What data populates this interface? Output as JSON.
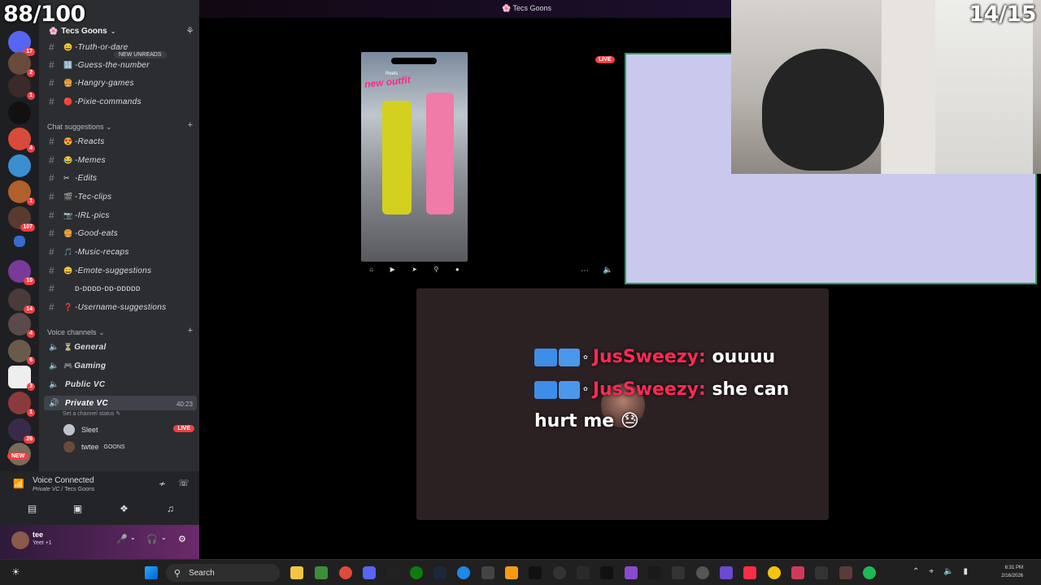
{
  "overlay": {
    "score_left": "88/100",
    "score_right": "14/15"
  },
  "window": {
    "title": "Tecs Goons"
  },
  "server_rail": {
    "badges": [
      "17",
      "2",
      "1",
      "4",
      "1",
      "107",
      "10",
      "14",
      "4",
      "6",
      "3",
      "1",
      "26"
    ],
    "new_label": "NEW"
  },
  "sidebar": {
    "server_name": "Tecs Goons",
    "new_unreads": "NEW UNREADS",
    "top_channels": [
      {
        "emoji": "😄",
        "label": "-Truth-or-dare"
      },
      {
        "emoji": "🔢",
        "label": "-Guess-the-number"
      },
      {
        "emoji": "🍔",
        "label": "-Hangry-games"
      },
      {
        "emoji": "🔴",
        "label": "-Pixie-commands"
      }
    ],
    "chat_category": "Chat suggestions",
    "chat_channels": [
      {
        "emoji": "😍",
        "label": "-Reacts"
      },
      {
        "emoji": "😂",
        "label": "-Memes"
      },
      {
        "emoji": "✂",
        "label": "-Edits"
      },
      {
        "emoji": "🎬",
        "label": "-Tec-clips"
      },
      {
        "emoji": "📷",
        "label": "-IRL-pics"
      },
      {
        "emoji": "🍔",
        "label": "-Good-eats"
      },
      {
        "emoji": "🎵",
        "label": "-Music-recaps"
      },
      {
        "emoji": "😀",
        "label": "-Emote-suggestions"
      },
      {
        "emoji": "",
        "label": "ᴅ-ᴅᴅᴅᴅ-ᴅᴅ-ᴅᴅᴅᴅᴅ"
      },
      {
        "emoji": "❓",
        "label": "-Username-suggestions"
      }
    ],
    "voice_category": "Voice channels",
    "voice_channels": [
      {
        "emoji": "⏳",
        "label": "General"
      },
      {
        "emoji": "🎮",
        "label": "Gaming"
      },
      {
        "emoji": "",
        "label": "Public VC"
      },
      {
        "emoji": "",
        "label": "Private VC"
      }
    ],
    "vc_timer": "40:23",
    "vc_status": "Set a channel status",
    "voice_users": [
      {
        "name": "Sleet",
        "tag": ""
      },
      {
        "name": "twtee",
        "tag": "GOONS"
      }
    ],
    "live_label": "LIVE"
  },
  "voice_panel": {
    "title": "Voice Connected",
    "channel": "Private VC",
    "server": "Tecs Goons",
    "user_name": "tee",
    "user_status": "Yeet +1"
  },
  "stage": {
    "live_label": "LIVE",
    "phone_reels": "Reels",
    "phone_caption": "new outfit"
  },
  "chat": [
    {
      "name": "JusSweezy:",
      "text": "ouuuu"
    },
    {
      "name": "JusSweezy:",
      "text": "she can hurt me 😓"
    }
  ],
  "taskbar": {
    "search_label": "Search",
    "time": "6:31 PM",
    "date": "2/16/2026"
  }
}
